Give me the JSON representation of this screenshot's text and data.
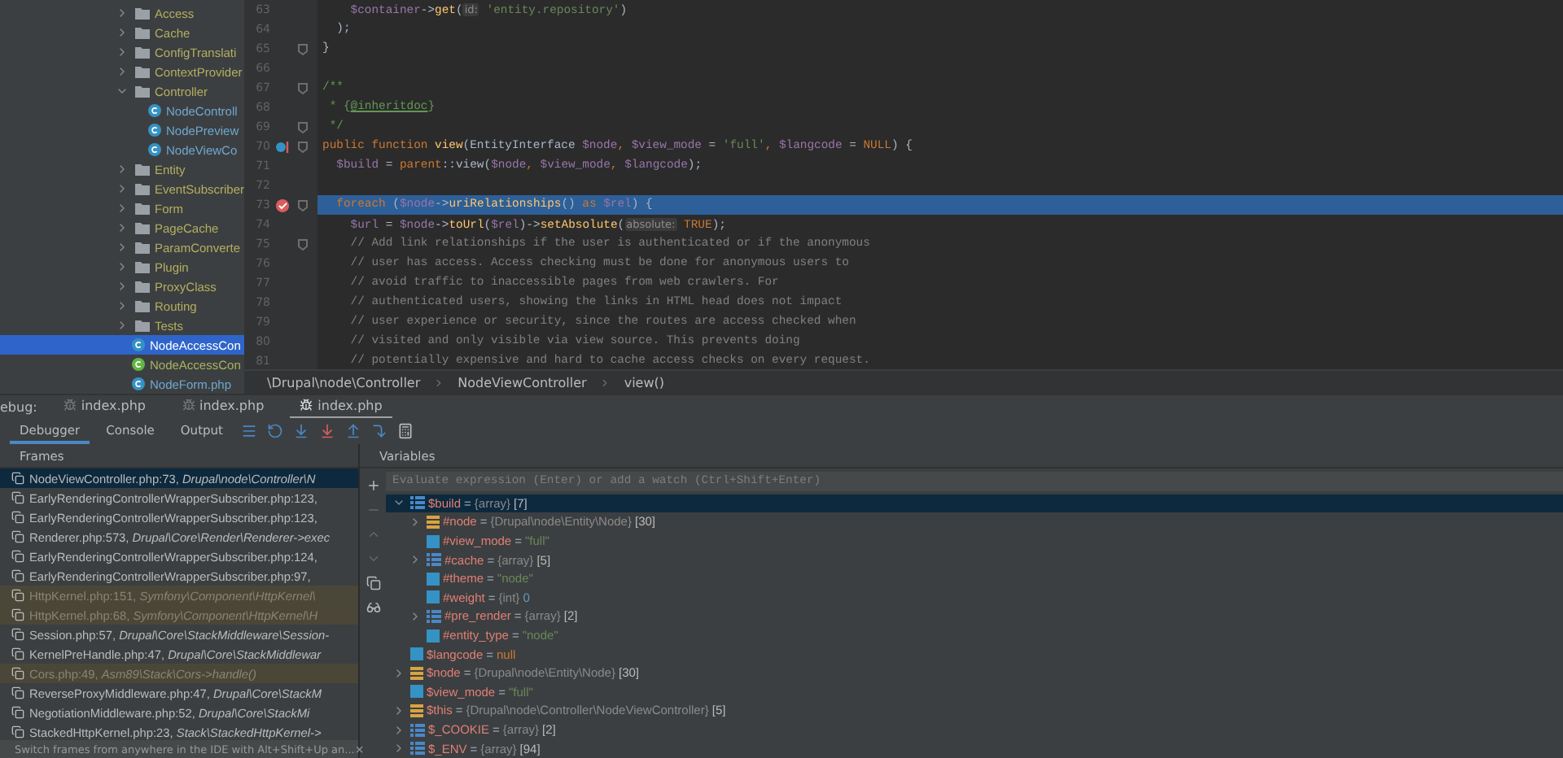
{
  "project_tree": {
    "items": [
      {
        "label": "Access",
        "kind": "folder",
        "expanded": false,
        "selected": false
      },
      {
        "label": "Cache",
        "kind": "folder",
        "expanded": false,
        "selected": false
      },
      {
        "label": "ConfigTranslati",
        "kind": "folder",
        "expanded": false,
        "selected": false
      },
      {
        "label": "ContextProvider",
        "kind": "folder",
        "expanded": false,
        "selected": false
      },
      {
        "label": "Controller",
        "kind": "folder",
        "expanded": true,
        "selected": false,
        "children": [
          {
            "label": "NodeControll",
            "kind": "class",
            "selected": false
          },
          {
            "label": "NodePreview",
            "kind": "class",
            "selected": false
          },
          {
            "label": "NodeViewCo",
            "kind": "class",
            "selected": false
          }
        ]
      },
      {
        "label": "Entity",
        "kind": "folder",
        "expanded": false,
        "selected": false
      },
      {
        "label": "EventSubscriber",
        "kind": "folder",
        "expanded": false,
        "selected": false
      },
      {
        "label": "Form",
        "kind": "folder",
        "expanded": false,
        "selected": false
      },
      {
        "label": "PageCache",
        "kind": "folder",
        "expanded": false,
        "selected": false
      },
      {
        "label": "ParamConverte",
        "kind": "folder",
        "expanded": false,
        "selected": false
      },
      {
        "label": "Plugin",
        "kind": "folder",
        "expanded": false,
        "selected": false
      },
      {
        "label": "ProxyClass",
        "kind": "folder",
        "expanded": false,
        "selected": false
      },
      {
        "label": "Routing",
        "kind": "folder",
        "expanded": false,
        "selected": false
      },
      {
        "label": "Tests",
        "kind": "folder",
        "expanded": false,
        "selected": false
      },
      {
        "label": "NodeAccessCon",
        "kind": "class",
        "selected": true
      },
      {
        "label": "NodeAccessCon",
        "kind": "interface",
        "selected": false
      },
      {
        "label": "NodeForm.php",
        "kind": "class",
        "selected": false
      }
    ]
  },
  "editor": {
    "lines": [
      {
        "number": "63",
        "tokens": [
          {
            "text": "    $container",
            "kind": "var"
          },
          {
            "text": "->",
            "kind": "plain"
          },
          {
            "text": "get",
            "kind": "fn"
          },
          {
            "text": "(",
            "kind": "plain"
          },
          {
            "text": "id:",
            "kind": "hint"
          },
          {
            "text": " 'entity.repository'",
            "kind": "str"
          },
          {
            "text": ")",
            "kind": "plain"
          }
        ]
      },
      {
        "number": "64",
        "tokens": [
          {
            "text": "  );",
            "kind": "plain"
          }
        ]
      },
      {
        "number": "65",
        "fold": true,
        "tokens": [
          {
            "text": "}",
            "kind": "plain"
          }
        ]
      },
      {
        "number": "66"
      },
      {
        "number": "67",
        "fold": true,
        "tokens": [
          {
            "text": "/**",
            "kind": "doc"
          }
        ]
      },
      {
        "number": "68",
        "tokens": [
          {
            "text": " * {",
            "kind": "doc"
          },
          {
            "text": "@inheritdoc",
            "kind": "doctag"
          },
          {
            "text": "}",
            "kind": "doc"
          }
        ]
      },
      {
        "number": "69",
        "fold": true,
        "tokens": [
          {
            "text": " */",
            "kind": "doc"
          }
        ]
      },
      {
        "number": "70",
        "fold": true,
        "override": true,
        "tokens": [
          {
            "text": "public function ",
            "kind": "kw"
          },
          {
            "text": "view",
            "kind": "fn"
          },
          {
            "text": "(EntityInterface ",
            "kind": "plain"
          },
          {
            "text": "$node",
            "kind": "var"
          },
          {
            "text": ", ",
            "kind": "kw"
          },
          {
            "text": "$view_mode",
            "kind": "var"
          },
          {
            "text": " = ",
            "kind": "plain"
          },
          {
            "text": "'full'",
            "kind": "str"
          },
          {
            "text": ", ",
            "kind": "kw"
          },
          {
            "text": "$langcode",
            "kind": "var"
          },
          {
            "text": " = ",
            "kind": "plain"
          },
          {
            "text": "NULL",
            "kind": "kw"
          },
          {
            "text": ") {",
            "kind": "plain"
          }
        ]
      },
      {
        "number": "71",
        "tokens": [
          {
            "text": "  $build",
            "kind": "var"
          },
          {
            "text": " = ",
            "kind": "plain"
          },
          {
            "text": "parent",
            "kind": "kw"
          },
          {
            "text": "::view(",
            "kind": "plain"
          },
          {
            "text": "$node",
            "kind": "var"
          },
          {
            "text": ", ",
            "kind": "kw"
          },
          {
            "text": "$view_mode",
            "kind": "var"
          },
          {
            "text": ", ",
            "kind": "kw"
          },
          {
            "text": "$langcode",
            "kind": "var"
          },
          {
            "text": ");",
            "kind": "plain"
          }
        ]
      },
      {
        "number": "72"
      },
      {
        "number": "73",
        "fold": true,
        "breakpoint": true,
        "current": true,
        "tokens": [
          {
            "text": "  foreach ",
            "kind": "kw"
          },
          {
            "text": "(",
            "kind": "plain"
          },
          {
            "text": "$node",
            "kind": "var"
          },
          {
            "text": "->",
            "kind": "plain"
          },
          {
            "text": "uriRelationships",
            "kind": "fn"
          },
          {
            "text": "() ",
            "kind": "plain"
          },
          {
            "text": "as ",
            "kind": "kw"
          },
          {
            "text": "$rel",
            "kind": "var"
          },
          {
            "text": ") {",
            "kind": "plain"
          }
        ]
      },
      {
        "number": "74",
        "tokens": [
          {
            "text": "    $url",
            "kind": "var"
          },
          {
            "text": " = ",
            "kind": "plain"
          },
          {
            "text": "$node",
            "kind": "var"
          },
          {
            "text": "->",
            "kind": "plain"
          },
          {
            "text": "toUrl",
            "kind": "fn"
          },
          {
            "text": "(",
            "kind": "plain"
          },
          {
            "text": "$rel",
            "kind": "var"
          },
          {
            "text": ")->",
            "kind": "plain"
          },
          {
            "text": "setAbsolute",
            "kind": "fn"
          },
          {
            "text": "(",
            "kind": "plain"
          },
          {
            "text": "absolute:",
            "kind": "hint"
          },
          {
            "text": " TRUE",
            "kind": "kw"
          },
          {
            "text": ");",
            "kind": "plain"
          }
        ]
      },
      {
        "number": "75",
        "fold": true,
        "tokens": [
          {
            "text": "    // Add link relationships if the user is authenticated or if the anonymous",
            "kind": "com"
          }
        ]
      },
      {
        "number": "76",
        "tokens": [
          {
            "text": "    // user has access. Access checking must be done for anonymous users to",
            "kind": "com"
          }
        ]
      },
      {
        "number": "77",
        "tokens": [
          {
            "text": "    // avoid traffic to inaccessible pages from web crawlers. For",
            "kind": "com"
          }
        ]
      },
      {
        "number": "78",
        "tokens": [
          {
            "text": "    // authenticated users, showing the links in HTML head does not impact",
            "kind": "com"
          }
        ]
      },
      {
        "number": "79",
        "tokens": [
          {
            "text": "    // user experience or security, since the routes are access checked when",
            "kind": "com"
          }
        ]
      },
      {
        "number": "80",
        "tokens": [
          {
            "text": "    // visited and only visible via view source. This prevents doing",
            "kind": "com"
          }
        ]
      },
      {
        "number": "81",
        "tokens": [
          {
            "text": "    // potentially expensive and hard to cache access checks on every request.",
            "kind": "com"
          }
        ]
      }
    ],
    "breadcrumb": [
      "\\Drupal\\node\\Controller",
      "NodeViewController",
      "view()"
    ]
  },
  "debug": {
    "label": "ebug:",
    "sessions": [
      {
        "label": "index.php",
        "selected": false
      },
      {
        "label": "index.php",
        "selected": false
      },
      {
        "label": "index.php",
        "selected": true
      }
    ],
    "tabs": [
      {
        "label": "Debugger",
        "selected": true
      },
      {
        "label": "Console",
        "selected": false
      },
      {
        "label": "Output",
        "selected": false
      }
    ],
    "frames": {
      "title": "Frames",
      "rows": [
        {
          "text": "NodeViewController.php:73, *Drupal\\node\\Controller\\N*",
          "library": false,
          "selected": true
        },
        {
          "text": "EarlyRenderingControllerWrapperSubscriber.php:123,",
          "library": false,
          "selected": false
        },
        {
          "text": "EarlyRenderingControllerWrapperSubscriber.php:123,",
          "library": false,
          "selected": false
        },
        {
          "text": "Renderer.php:573, *Drupal\\Core\\Render\\Renderer->exec*",
          "library": false,
          "selected": false
        },
        {
          "text": "EarlyRenderingControllerWrapperSubscriber.php:124,",
          "library": false,
          "selected": false
        },
        {
          "text": "EarlyRenderingControllerWrapperSubscriber.php:97,",
          "library": false,
          "selected": false
        },
        {
          "text": "HttpKernel.php:151, *Symfony\\Component\\HttpKernel\\*",
          "library": true,
          "selected": false
        },
        {
          "text": "HttpKernel.php:68, *Symfony\\Component\\HttpKernel\\H*",
          "library": true,
          "selected": false
        },
        {
          "text": "Session.php:57, *Drupal\\Core\\StackMiddleware\\Session-*",
          "library": false,
          "selected": false
        },
        {
          "text": "KernelPreHandle.php:47, *Drupal\\Core\\StackMiddlewar*",
          "library": false,
          "selected": false
        },
        {
          "text": "Cors.php:49, *Asm89\\Stack\\Cors->handle()*",
          "library": true,
          "selected": false
        },
        {
          "text": "ReverseProxyMiddleware.php:47, *Drupal\\Core\\StackM*",
          "library": false,
          "selected": false
        },
        {
          "text": "NegotiationMiddleware.php:52, *Drupal\\Core\\StackMi*",
          "library": false,
          "selected": false
        },
        {
          "text": "StackedHttpKernel.php:23, *Stack\\StackedHttpKernel->*",
          "library": false,
          "selected": false
        }
      ],
      "hint": "Switch frames from anywhere in the IDE with Alt+Shift+Up an...",
      "hint_close": "×"
    },
    "variables": {
      "title": "Variables",
      "placeholder": "Evaluate expression (Enter) or add a watch (Ctrl+Shift+Enter)",
      "items": [
        {
          "name": "$build",
          "equals": "=",
          "type": "{array}",
          "value": {
            "text": "[7]",
            "kind": "count"
          },
          "kind": "array",
          "expanded": true,
          "selected": true,
          "children": [
            {
              "name": "#node",
              "equals": "=",
              "type": "{Drupal\\node\\Entity\\Node}",
              "value": {
                "text": "[30]",
                "kind": "count"
              },
              "kind": "object",
              "expanded": false,
              "selected": false
            },
            {
              "name": "#view_mode",
              "equals": "=",
              "value": {
                "text": "\"full\"",
                "kind": "string"
              },
              "kind": "scalar",
              "selected": false
            },
            {
              "name": "#cache",
              "equals": "=",
              "type": "{array}",
              "value": {
                "text": "[5]",
                "kind": "count"
              },
              "kind": "array",
              "expanded": false,
              "selected": false
            },
            {
              "name": "#theme",
              "equals": "=",
              "value": {
                "text": "\"node\"",
                "kind": "string"
              },
              "kind": "scalar",
              "selected": false
            },
            {
              "name": "#weight",
              "equals": "=",
              "type": "{int}",
              "value": {
                "text": "0",
                "kind": "number"
              },
              "kind": "scalar",
              "selected": false
            },
            {
              "name": "#pre_render",
              "equals": "=",
              "type": "{array}",
              "value": {
                "text": "[2]",
                "kind": "count"
              },
              "kind": "array",
              "expanded": false,
              "selected": false
            },
            {
              "name": "#entity_type",
              "equals": "=",
              "value": {
                "text": "\"node\"",
                "kind": "string"
              },
              "kind": "scalar",
              "selected": false
            }
          ]
        },
        {
          "name": "$langcode",
          "equals": "=",
          "value": {
            "text": "null",
            "kind": "null"
          },
          "kind": "scalar",
          "selected": false
        },
        {
          "name": "$node",
          "equals": "=",
          "type": "{Drupal\\node\\Entity\\Node}",
          "value": {
            "text": "[30]",
            "kind": "count"
          },
          "kind": "object",
          "expanded": false,
          "selected": false
        },
        {
          "name": "$view_mode",
          "equals": "=",
          "value": {
            "text": "\"full\"",
            "kind": "string"
          },
          "kind": "scalar",
          "selected": false
        },
        {
          "name": "$this",
          "equals": "=",
          "type": "{Drupal\\node\\Controller\\NodeViewController}",
          "value": {
            "text": "[5]",
            "kind": "count"
          },
          "kind": "object",
          "expanded": false,
          "selected": false
        },
        {
          "name": "$_COOKIE",
          "equals": "=",
          "type": "{array}",
          "value": {
            "text": "[2]",
            "kind": "count"
          },
          "kind": "array",
          "expanded": false,
          "selected": false
        },
        {
          "name": "$_ENV",
          "equals": "=",
          "type": "{array}",
          "value": {
            "text": "[94]",
            "kind": "count"
          },
          "kind": "array",
          "expanded": false,
          "selected": false
        }
      ]
    }
  }
}
